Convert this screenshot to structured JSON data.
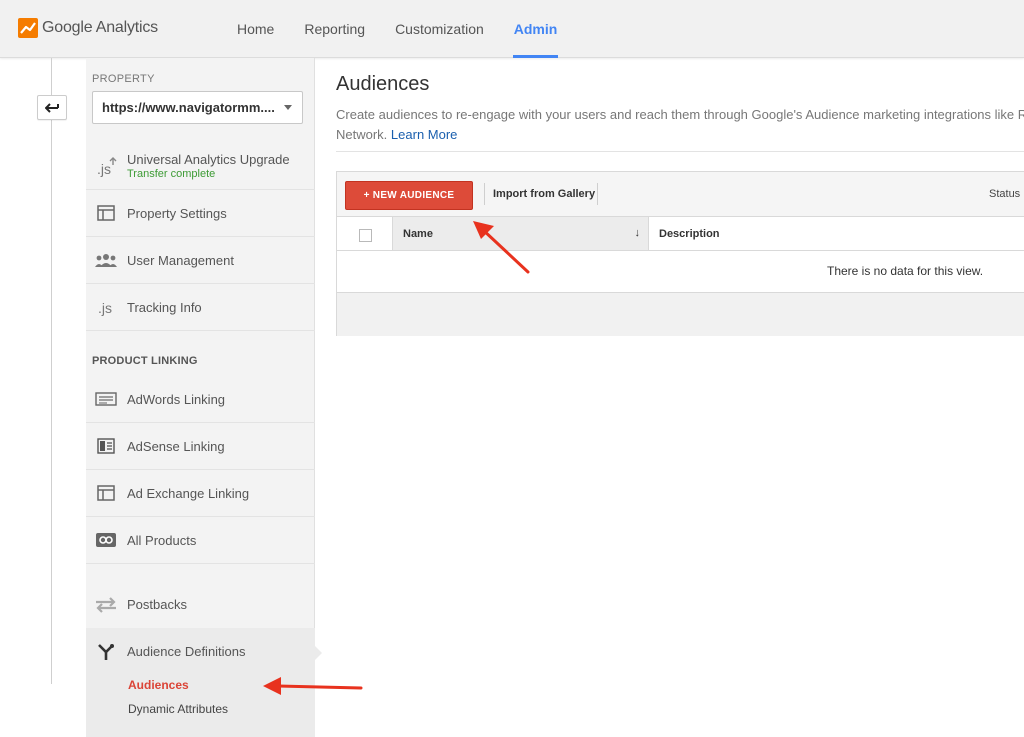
{
  "app": {
    "logo_text": "Google Analytics"
  },
  "nav": {
    "items": [
      {
        "label": "Home"
      },
      {
        "label": "Reporting"
      },
      {
        "label": "Customization"
      },
      {
        "label": "Admin",
        "active": true
      }
    ]
  },
  "sidebar": {
    "property_label": "PROPERTY",
    "property_value": "https://www.navigatormm....",
    "items": [
      {
        "label": "Universal Analytics Upgrade",
        "sublabel": "Transfer complete",
        "icon": "js-upgrade-icon"
      },
      {
        "label": "Property Settings",
        "icon": "window-icon"
      },
      {
        "label": "User Management",
        "icon": "users-icon"
      },
      {
        "label": "Tracking Info",
        "icon": "js-icon"
      }
    ],
    "product_linking_heading": "PRODUCT LINKING",
    "linking_items": [
      {
        "label": "AdWords Linking",
        "icon": "adwords-icon"
      },
      {
        "label": "AdSense Linking",
        "icon": "adsense-icon"
      },
      {
        "label": "Ad Exchange Linking",
        "icon": "ad-exchange-icon"
      },
      {
        "label": "All Products",
        "icon": "link-icon"
      }
    ],
    "postbacks_label": "Postbacks",
    "audience_definitions_label": "Audience Definitions",
    "sub_items": [
      {
        "label": "Audiences",
        "active": true
      },
      {
        "label": "Dynamic Attributes"
      }
    ]
  },
  "main": {
    "title": "Audiences",
    "description_line1": "Create audiences to re-engage with your users and reach them through Google's Audience marketing integrations like Re",
    "description_line2": "Network.",
    "learn_more": "Learn More",
    "toolbar": {
      "new_audience": "+ NEW AUDIENCE",
      "import_gallery": "Import from Gallery",
      "status": "Status"
    },
    "table": {
      "columns": [
        "Name",
        "Description"
      ],
      "sort_indicator": "↓",
      "empty_message": "There is no data for this view."
    }
  },
  "colors": {
    "accent_blue": "#4285f4",
    "button_red": "#dd4b39",
    "active_red": "#db4437",
    "success_green": "#3d9b35",
    "annotation_red": "#e8321e"
  }
}
